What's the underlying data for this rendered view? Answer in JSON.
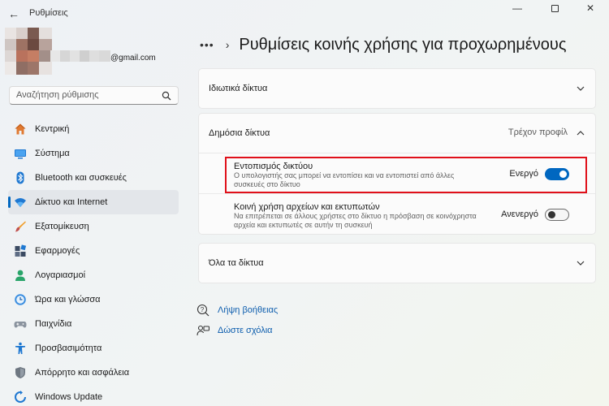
{
  "window": {
    "title": "Ρυθμίσεις",
    "back_glyph": "←",
    "minimize_glyph": "—",
    "close_glyph": "✕"
  },
  "account": {
    "email_suffix": "@gmail.com",
    "avatar_icon": "blurred-avatar"
  },
  "search": {
    "placeholder": "Αναζήτηση ρύθμισης",
    "icon": "search-icon"
  },
  "sidebar": {
    "items": [
      {
        "label": "Κεντρική",
        "icon": "home-icon",
        "active": false
      },
      {
        "label": "Σύστημα",
        "icon": "monitor-icon",
        "active": false
      },
      {
        "label": "Bluetooth και συσκευές",
        "icon": "bluetooth-icon",
        "active": false
      },
      {
        "label": "Δίκτυο και Internet",
        "icon": "wifi-icon",
        "active": true
      },
      {
        "label": "Εξατομίκευση",
        "icon": "brush-icon",
        "active": false
      },
      {
        "label": "Εφαρμογές",
        "icon": "apps-icon",
        "active": false
      },
      {
        "label": "Λογαριασμοί",
        "icon": "person-icon",
        "active": false
      },
      {
        "label": "Ώρα και γλώσσα",
        "icon": "clock-globe-icon",
        "active": false
      },
      {
        "label": "Παιχνίδια",
        "icon": "gamepad-icon",
        "active": false
      },
      {
        "label": "Προσβασιμότητα",
        "icon": "accessibility-icon",
        "active": false
      },
      {
        "label": "Απόρρητο και ασφάλεια",
        "icon": "shield-icon",
        "active": false
      },
      {
        "label": "Windows Update",
        "icon": "update-icon",
        "active": false
      }
    ]
  },
  "header": {
    "more_glyph": "•••",
    "separator_glyph": "›",
    "title": "Ρυθμίσεις κοινής χρήσης για προχωρημένους"
  },
  "sections": {
    "private": {
      "label": "Ιδιωτικά δίκτυα",
      "expanded": false
    },
    "public": {
      "label": "Δημόσια δίκτυα",
      "profile": "Τρέχον προφίλ",
      "expanded": true,
      "discovery": {
        "title": "Εντοπισμός δικτύου",
        "desc": "Ο υπολογιστής σας μπορεί να εντοπίσει και να εντοπιστεί από άλλες συσκευές στο δίκτυο",
        "state": "Ενεργό",
        "on": true
      },
      "sharing": {
        "title": "Κοινή χρήση αρχείων και εκτυπωτών",
        "desc": "Να επιτρέπεται σε άλλους χρήστες στο δίκτυο η πρόσβαση σε κοινόχρηστα αρχεία και εκτυπωτές σε αυτήν τη συσκευή",
        "state": "Ανενεργό",
        "on": false
      }
    },
    "all": {
      "label": "Όλα τα δίκτυα",
      "expanded": false
    }
  },
  "links": {
    "help": "Λήψη βοήθειας",
    "feedback": "Δώστε σχόλια"
  },
  "colors": {
    "accent": "#0067c0",
    "highlight": "#e0101a",
    "link": "#0b5cad"
  }
}
